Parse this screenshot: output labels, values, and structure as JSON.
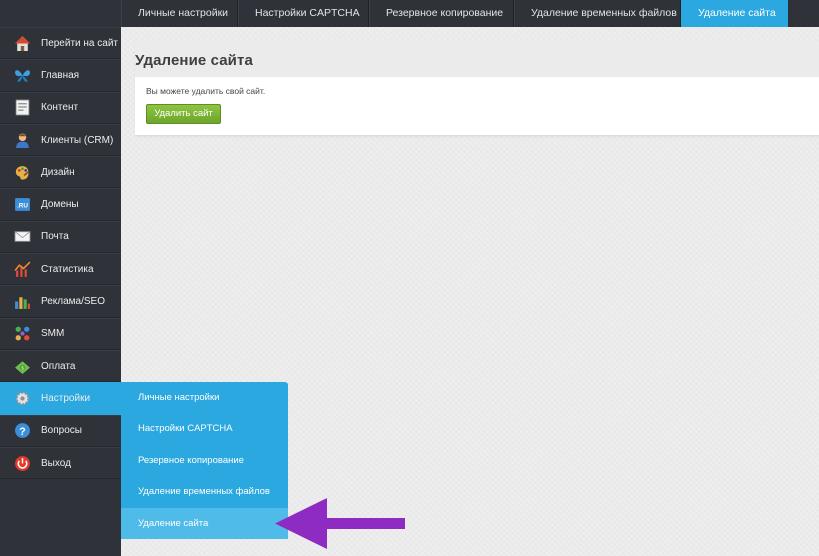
{
  "topbar": {
    "tabs": [
      {
        "label": "Личные настройки"
      },
      {
        "label": "Настройки CAPTCHA"
      },
      {
        "label": "Резервное копирование"
      },
      {
        "label": "Удаление временных файлов"
      },
      {
        "label": "Удаление сайта"
      }
    ],
    "active_tab": "Удаление сайта"
  },
  "sidebar": {
    "items": [
      {
        "label": "Перейти на сайт",
        "icon": "home-icon"
      },
      {
        "label": "Главная",
        "icon": "butterfly-icon"
      },
      {
        "label": "Контент",
        "icon": "document-icon"
      },
      {
        "label": "Клиенты (CRM)",
        "icon": "user-icon"
      },
      {
        "label": "Дизайн",
        "icon": "palette-icon"
      },
      {
        "label": "Домены",
        "icon": "ru-domain-icon"
      },
      {
        "label": "Почта",
        "icon": "envelope-icon"
      },
      {
        "label": "Статистика",
        "icon": "chart-line-icon"
      },
      {
        "label": "Реклама/SEO",
        "icon": "bar-chart-icon"
      },
      {
        "label": "SMM",
        "icon": "network-icon"
      },
      {
        "label": "Оплата",
        "icon": "money-icon"
      },
      {
        "label": "Настройки",
        "icon": "gear-icon"
      },
      {
        "label": "Вопросы",
        "icon": "question-icon"
      },
      {
        "label": "Выход",
        "icon": "power-icon"
      }
    ],
    "active_item": "Настройки"
  },
  "main": {
    "title": "Удаление сайта",
    "description": "Вы можете удалить свой сайт.",
    "delete_button": "Удалить сайт"
  },
  "submenu": {
    "items": [
      {
        "label": "Личные настройки"
      },
      {
        "label": "Настройки CAPTCHA"
      },
      {
        "label": "Резервное копирование"
      },
      {
        "label": "Удаление временных файлов"
      },
      {
        "label": "Удаление сайта"
      }
    ],
    "active_item": "Удаление сайта"
  },
  "colors": {
    "sidebar_bg": "#2f3238",
    "accent_blue": "#2aa8df",
    "button_green": "#7cb53a",
    "arrow_purple": "#8e2bc2"
  }
}
